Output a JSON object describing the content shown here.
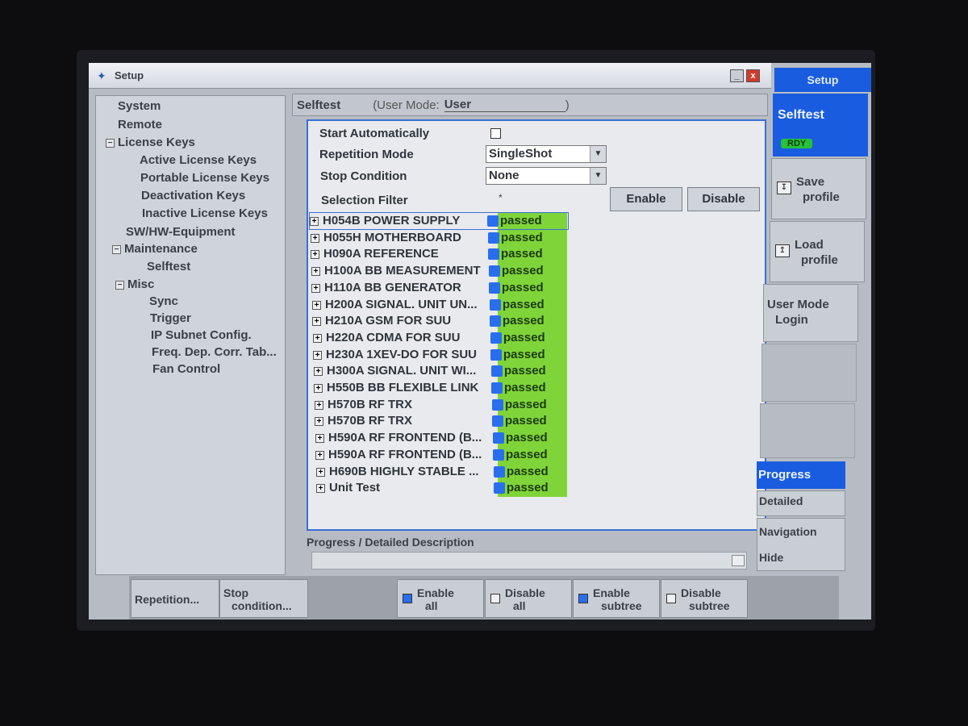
{
  "window": {
    "title": "Setup",
    "min_label": "_",
    "close_label": "x"
  },
  "tree": [
    {
      "label": "System",
      "toggle": ""
    },
    {
      "label": "Remote",
      "toggle": ""
    },
    {
      "label": "License Keys",
      "toggle": "−"
    },
    {
      "label": "Active License Keys",
      "toggle": ""
    },
    {
      "label": "Portable License Keys",
      "toggle": ""
    },
    {
      "label": "Deactivation Keys",
      "toggle": ""
    },
    {
      "label": "Inactive License Keys",
      "toggle": ""
    },
    {
      "label": "SW/HW-Equipment",
      "toggle": ""
    },
    {
      "label": "Maintenance",
      "toggle": "−"
    },
    {
      "label": "Selftest",
      "toggle": ""
    },
    {
      "label": "Misc",
      "toggle": "−"
    },
    {
      "label": "Sync",
      "toggle": ""
    },
    {
      "label": "Trigger",
      "toggle": ""
    },
    {
      "label": "IP Subnet Config.",
      "toggle": ""
    },
    {
      "label": "Freq. Dep. Corr. Tab...",
      "toggle": ""
    },
    {
      "label": "Fan Control",
      "toggle": ""
    }
  ],
  "header": {
    "section": "Selftest",
    "user_mode_label": "(User Mode:",
    "user_mode_value": "User",
    "close_paren": ")"
  },
  "settings": {
    "start_auto_label": "Start Automatically",
    "repetition_label": "Repetition Mode",
    "repetition_value": "SingleShot",
    "stop_label": "Stop Condition",
    "stop_value": "None",
    "filter_label": "Selection Filter",
    "filter_value": "*",
    "enable_label": "Enable",
    "disable_label": "Disable",
    "arrow": "▼"
  },
  "tests": [
    {
      "name": "H054B POWER SUPPLY",
      "status": "passed"
    },
    {
      "name": "H055H MOTHERBOARD",
      "status": "passed"
    },
    {
      "name": "H090A REFERENCE",
      "status": "passed"
    },
    {
      "name": "H100A BB MEASUREMENT",
      "status": "passed"
    },
    {
      "name": "H110A BB GENERATOR",
      "status": "passed"
    },
    {
      "name": "H200A SIGNAL. UNIT UN...",
      "status": "passed"
    },
    {
      "name": "H210A GSM FOR SUU",
      "status": "passed"
    },
    {
      "name": "H220A CDMA FOR SUU",
      "status": "passed"
    },
    {
      "name": "H230A 1XEV-DO FOR SUU",
      "status": "passed"
    },
    {
      "name": "H300A SIGNAL. UNIT WI...",
      "status": "passed"
    },
    {
      "name": "H550B BB FLEXIBLE LINK",
      "status": "passed"
    },
    {
      "name": "H570B RF TRX",
      "status": "passed"
    },
    {
      "name": "H570B RF TRX",
      "status": "passed"
    },
    {
      "name": "H590A RF FRONTEND (B...",
      "status": "passed"
    },
    {
      "name": "H590A RF FRONTEND (B...",
      "status": "passed"
    },
    {
      "name": "H690B HIGHLY STABLE ...",
      "status": "passed"
    },
    {
      "name": "Unit Test",
      "status": "passed"
    }
  ],
  "tree_toggle": "+",
  "description_label": "Progress / Detailed Description",
  "softkeys": {
    "title": "Setup",
    "selftest": "Selftest",
    "rdy": "RDY",
    "save_l1": "Save",
    "save_l2": "profile",
    "load_l1": "Load",
    "load_l2": "profile",
    "user_l1": "User Mode",
    "user_l2": "Login",
    "progress": "Progress",
    "detailed": "Detailed",
    "navigation": "Navigation",
    "hide": "Hide"
  },
  "bottom": {
    "repetition": "Repetition...",
    "stop_l1": "Stop",
    "stop_l2": "condition...",
    "enable_all_l1": "Enable",
    "enable_all_l2": "all",
    "disable_all_l1": "Disable",
    "disable_all_l2": "all",
    "enable_sub_l1": "Enable",
    "enable_sub_l2": "subtree",
    "disable_sub_l1": "Disable",
    "disable_sub_l2": "subtree"
  }
}
